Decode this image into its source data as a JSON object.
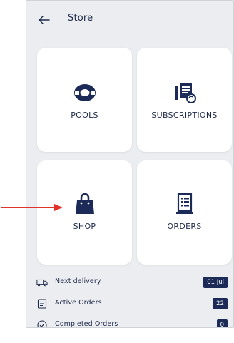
{
  "header": {
    "title": "Store",
    "back_icon": "arrow-left-icon"
  },
  "tiles": [
    {
      "label": "POOLS",
      "icon": "lifebuoy-icon"
    },
    {
      "label": "SUBSCRIPTIONS",
      "icon": "subscription-receipt-icon"
    },
    {
      "label": "SHOP",
      "icon": "shopping-bag-icon"
    },
    {
      "label": "ORDERS",
      "icon": "order-list-icon"
    }
  ],
  "stats": [
    {
      "label": "Next delivery",
      "value": "01 Jul",
      "icon": "truck-icon"
    },
    {
      "label": "Active Orders",
      "value": "22",
      "icon": "order-list-icon"
    },
    {
      "label": "Completed Orders",
      "value": "0",
      "icon": "check-circle-icon"
    }
  ],
  "colors": {
    "navy": "#1c2a57",
    "annotation_red": "#e0342b",
    "background": "#ebedf0"
  }
}
